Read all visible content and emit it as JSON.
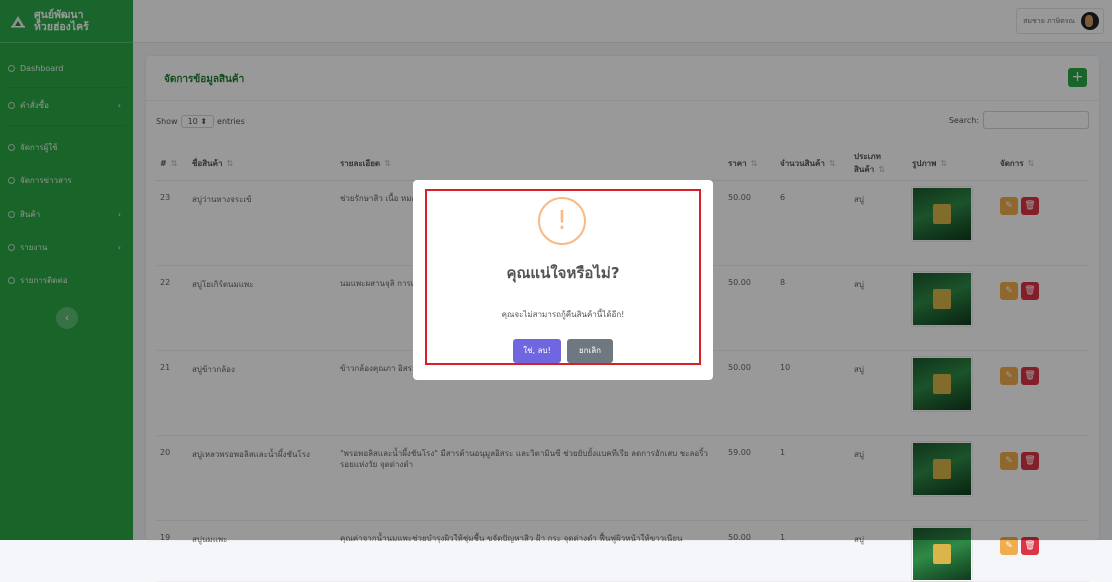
{
  "brand": {
    "line1": "ศูนย์พัฒนา",
    "line2": "ห้วยฮ่องไคร้"
  },
  "sidebar": {
    "items": [
      {
        "label": "Dashboard",
        "has_arrow": false
      },
      {
        "label": "คำสั่งซื้อ",
        "has_arrow": true
      },
      {
        "label": "จัดการผู้ใช้",
        "has_arrow": false
      },
      {
        "label": "จัดการข่าวสาร",
        "has_arrow": false
      },
      {
        "label": "สินค้า",
        "has_arrow": true
      },
      {
        "label": "รายงาน",
        "has_arrow": true
      },
      {
        "label": "รายการติดต่อ",
        "has_arrow": false
      }
    ],
    "collapse_icon": "‹"
  },
  "topbar": {
    "user_name": "สมชาย ภาษิตรณ"
  },
  "card": {
    "title": "จัดการข้อมูลสินค้า",
    "add_label": "+"
  },
  "controls": {
    "show_label": "Show",
    "length_value": "10",
    "entries_label": "entries",
    "search_label": "Search:"
  },
  "table": {
    "headers": [
      "#",
      "ชื่อสินค้า",
      "รายละเอียด",
      "ราคา",
      "จำนวนสินค้า",
      "ประเภทสินค้า",
      "รูปภาพ",
      "จัดการ"
    ],
    "rows": [
      {
        "id": "23",
        "name": "สบู่ว่านหางจระเข้",
        "desc": "ช่วยรักษาสิว เนื้อ หมอง และยังช่วย",
        "price": "50.00",
        "qty": "6",
        "type": "สบู่"
      },
      {
        "id": "22",
        "name": "สบู่โยเกิร์ตนมแพะ",
        "desc": "นมแพะผสานจุลิ การเกิดสิวเนื้อใช้",
        "price": "50.00",
        "qty": "8",
        "type": "สบู่"
      },
      {
        "id": "21",
        "name": "สบู่ข้าวกล้อง",
        "desc": "ข้าวกล้องคุณภา อิสระ",
        "price": "50.00",
        "qty": "10",
        "type": "สบู่"
      },
      {
        "id": "20",
        "name": "สบู่เหลวพรอพอลิสและน้ำผึ้งชันโรง",
        "desc": "\"พรอพอลิสและน้ำผึ้งชันโรง\" มีสารต้านอนุมูลอิสระ และวิตามินซี ช่วยยับยั้งแบคทีเรีย ลดการอักเสบ ชะลอริ้วรอยแห่งวัย จุดด่างดำ",
        "price": "59.00",
        "qty": "1",
        "type": "สบู่"
      },
      {
        "id": "19",
        "name": "สบู่นมแพะ",
        "desc": "คุณค่าจากน้ำนมแพะช่วยบำรุงผิวให้ชุ่มชื้น ขจัดปัญหาสิว ฝ้า กระ จุดด่างดำ ฟื้นฟูผิวหน้าให้ขาวเนียน",
        "price": "50.00",
        "qty": "1",
        "type": "สบู่"
      }
    ],
    "edit_icon": "✎",
    "delete_icon": "🗑"
  },
  "modal": {
    "icon": "!",
    "title": "คุณแน่ใจหรือไม่?",
    "text": "คุณจะไม่สามารถกู้คืนสินค้านี้ได้อีก!",
    "confirm_label": "ใช่, ลบ!",
    "cancel_label": "ยกเลิก"
  }
}
